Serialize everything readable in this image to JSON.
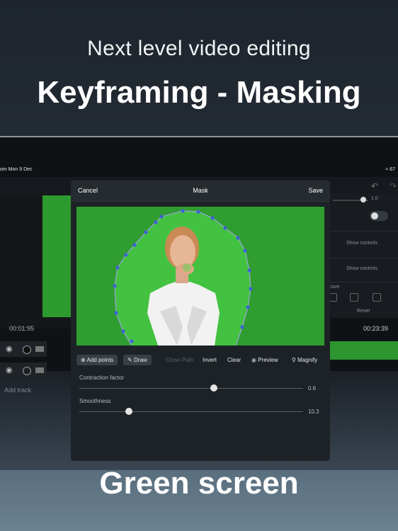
{
  "hero": {
    "subtitle": "Next level video editing",
    "title": "Keyframing - Masking",
    "bottom": "Green screen"
  },
  "device": {
    "status_time": "om  Mon 9 Dec",
    "status_battery": "67",
    "timecode_left": "00:01:95",
    "timecode_right": "00:23:39",
    "add_track_label": "Add track",
    "right_panel": {
      "slider_value": "1.0",
      "show_controls_1": "Show controls",
      "show_controls_2": "Show controls",
      "section_label": "cture",
      "reset_label": "Reset"
    }
  },
  "mask_dialog": {
    "cancel_label": "Cancel",
    "title": "Mask",
    "save_label": "Save",
    "tools": {
      "add_points": "Add points",
      "draw": "Draw",
      "close_path": "Close Path",
      "invert": "Invert",
      "clear": "Clear",
      "preview": "Preview",
      "magnify": "Magnify"
    },
    "sliders": {
      "contraction_label": "Contraction factor",
      "contraction_value": "0.6",
      "contraction_fraction": 0.6,
      "smoothness_label": "Smoothness",
      "smoothness_value": "10.3",
      "smoothness_fraction": 0.22
    }
  },
  "colors": {
    "green_screen": "#2f9d30",
    "mask_path": "#3e63d8",
    "accent": "#3a3f44"
  }
}
